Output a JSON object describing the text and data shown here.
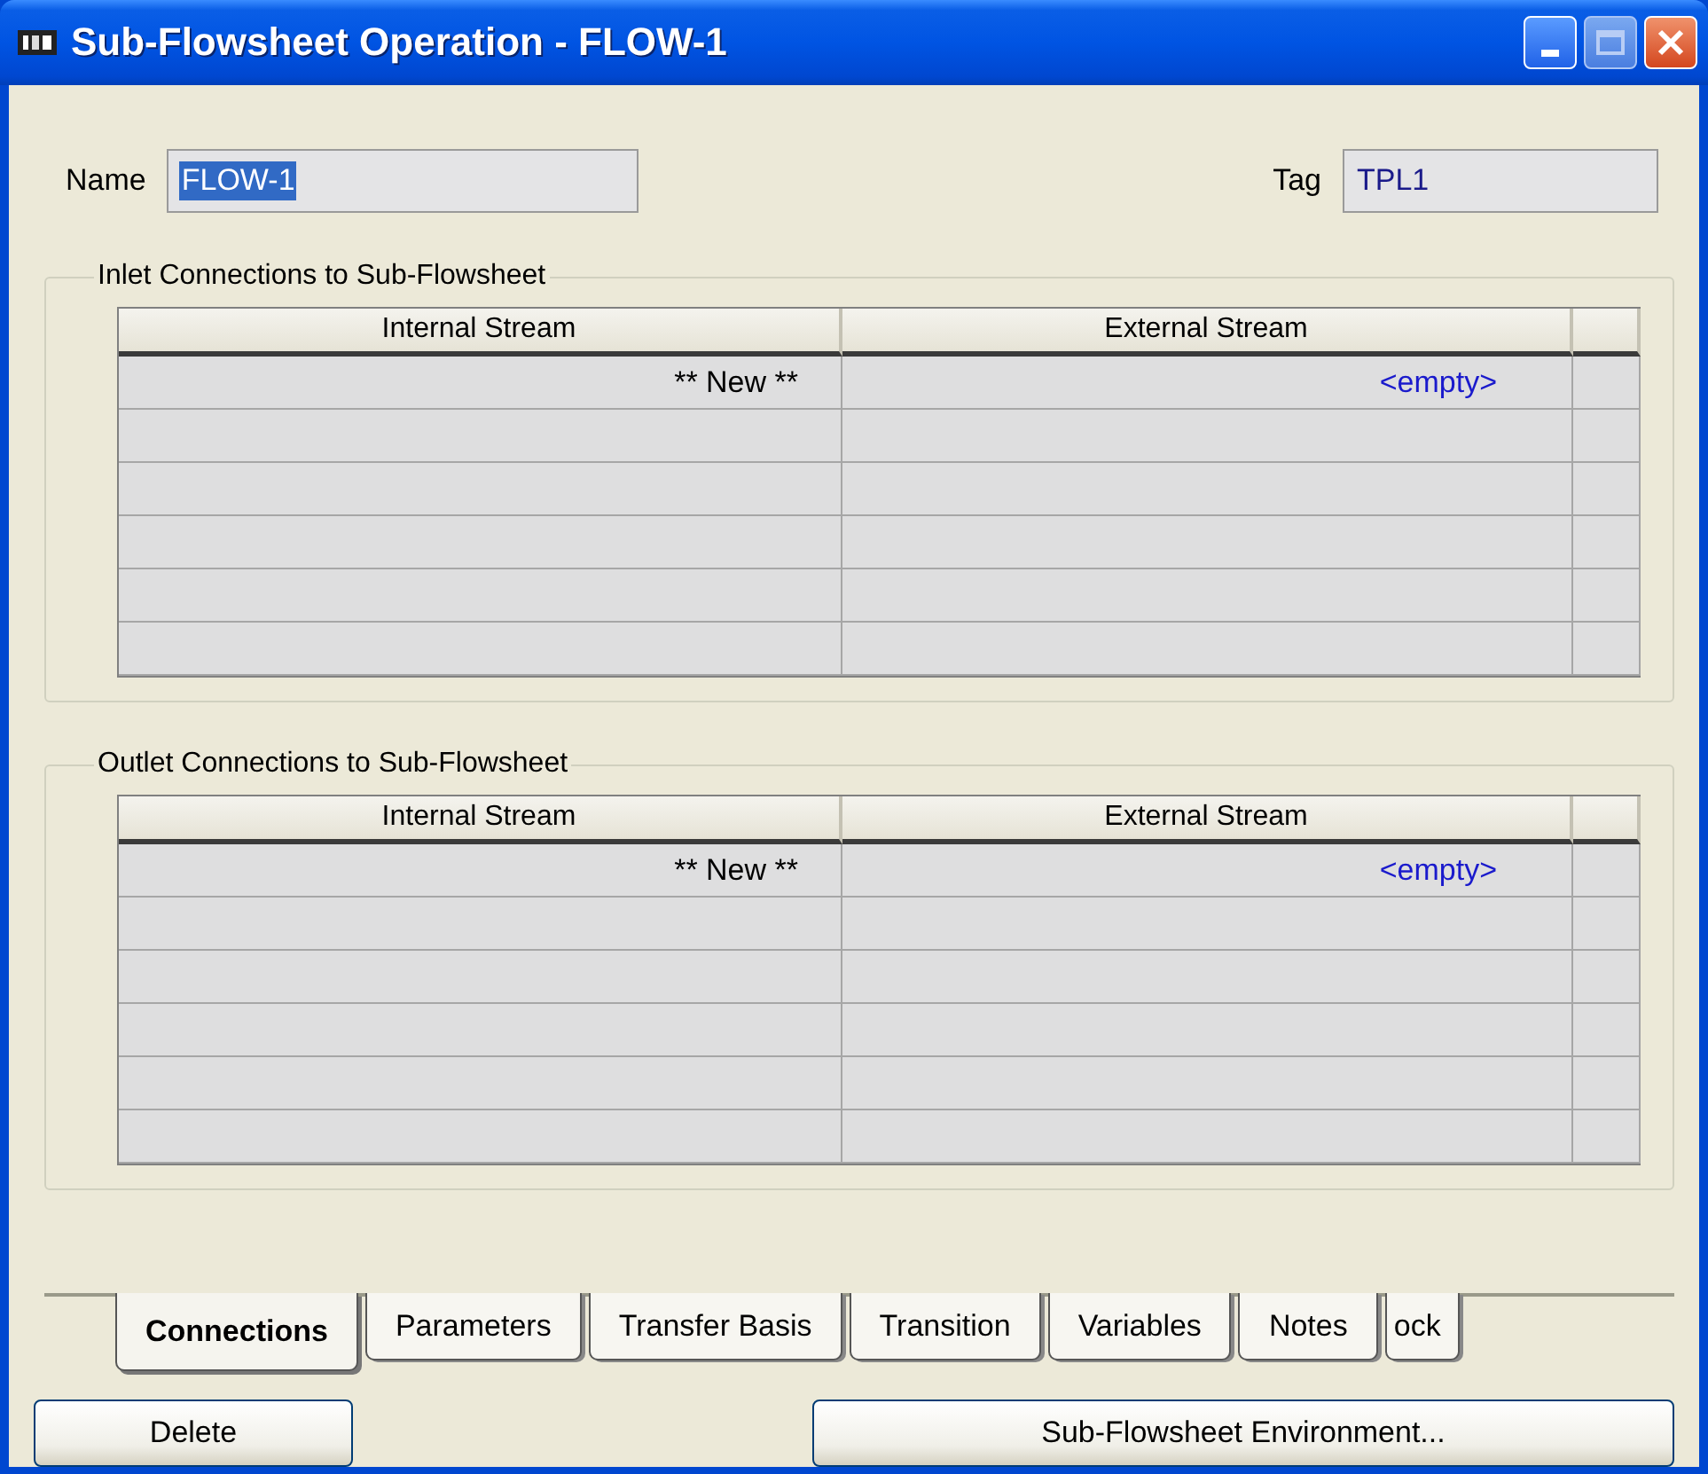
{
  "window": {
    "title": "Sub-Flowsheet Operation - FLOW-1"
  },
  "fields": [
    {
      "label": "Name",
      "value": "FLOW-1",
      "text_selected": true
    },
    {
      "label": "Tag",
      "value": "TPL1",
      "text_selected": false
    }
  ],
  "groups": [
    {
      "title": "Inlet Connections to Sub-Flowsheet",
      "columns": [
        "Internal Stream",
        "External Stream"
      ],
      "rows": [
        {
          "internal": "** New **",
          "external": "<empty>"
        }
      ]
    },
    {
      "title": "Outlet Connections to Sub-Flowsheet",
      "columns": [
        "Internal Stream",
        "External Stream"
      ],
      "rows": [
        {
          "internal": "** New **",
          "external": "<empty>"
        }
      ]
    }
  ],
  "tabs": [
    {
      "label": "Connections",
      "selected": true
    },
    {
      "label": "Parameters",
      "selected": false
    },
    {
      "label": "Transfer Basis",
      "selected": false
    },
    {
      "label": "Transition",
      "selected": false
    },
    {
      "label": "Variables",
      "selected": false
    },
    {
      "label": "Notes",
      "selected": false
    },
    {
      "label": "ock",
      "selected": false
    }
  ],
  "buttons": [
    "Delete",
    "Sub-Flowsheet Environment..."
  ]
}
